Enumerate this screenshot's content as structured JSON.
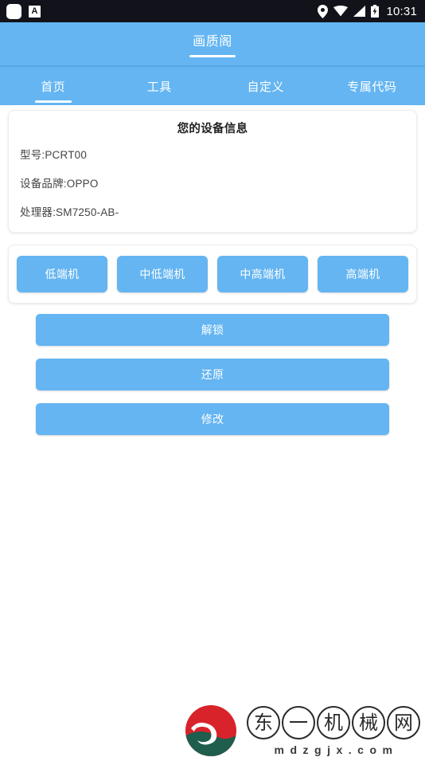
{
  "status_bar": {
    "icons_left": [
      "app-blank-icon",
      "app-letter-a-icon"
    ],
    "letter_a": "A",
    "icons_right": [
      "location-pin-icon",
      "wifi-icon",
      "signal-icon",
      "battery-charging-icon"
    ],
    "time": "10:31"
  },
  "app_bar": {
    "title": "画质阁"
  },
  "tabs": [
    {
      "label": "首页",
      "active": true
    },
    {
      "label": "工具",
      "active": false
    },
    {
      "label": "自定义",
      "active": false
    },
    {
      "label": "专属代码",
      "active": false
    }
  ],
  "device_card": {
    "title": "您的设备信息",
    "rows": [
      "型号:PCRT00",
      "设备品牌:OPPO",
      "处理器:SM7250-AB-"
    ]
  },
  "presets": [
    {
      "label": "低端机"
    },
    {
      "label": "中低端机"
    },
    {
      "label": "中高端机"
    },
    {
      "label": "高端机"
    }
  ],
  "actions": [
    {
      "label": "解锁"
    },
    {
      "label": "还原"
    },
    {
      "label": "修改"
    }
  ],
  "watermark": {
    "logo_name": "dongyi-machinery-logo",
    "characters": [
      "东",
      "一",
      "机",
      "械",
      "网"
    ],
    "domain": "mdzgjx.com"
  },
  "colors": {
    "accent_blue": "#64b5f1",
    "appbar_divider": "#55a7e6",
    "status_bar": "#12131a",
    "page_background": "#ffffff",
    "logo_red": "#d8232a",
    "logo_green": "#1f5d4c"
  }
}
